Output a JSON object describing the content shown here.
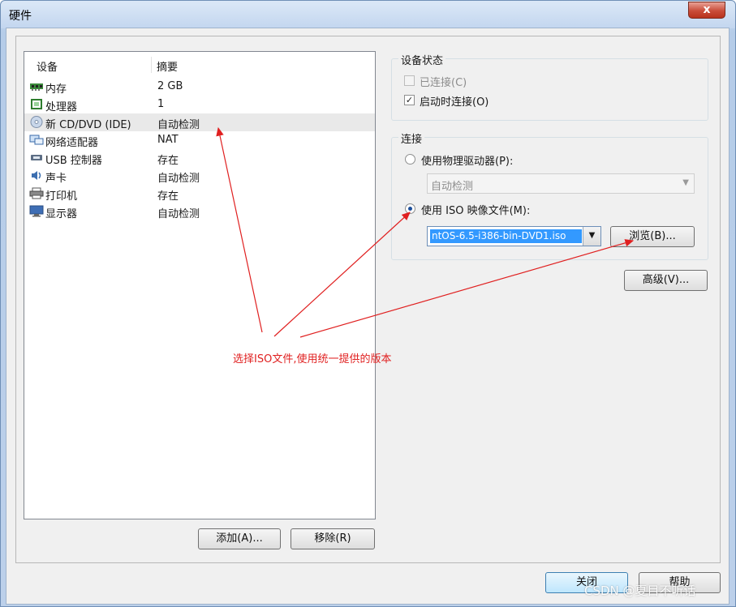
{
  "window": {
    "title": "硬件",
    "close_glyph": "x"
  },
  "device_list": {
    "header_device": "设备",
    "header_summary": "摘要",
    "rows": [
      {
        "name": "内存",
        "summary": "2 GB",
        "icon": "memory-icon"
      },
      {
        "name": "处理器",
        "summary": "1",
        "icon": "processor-icon"
      },
      {
        "name": "新 CD/DVD (IDE)",
        "summary": "自动检测",
        "icon": "cd-dvd-icon"
      },
      {
        "name": "网络适配器",
        "summary": "NAT",
        "icon": "network-adapter-icon"
      },
      {
        "name": "USB 控制器",
        "summary": "存在",
        "icon": "usb-icon"
      },
      {
        "name": "声卡",
        "summary": "自动检测",
        "icon": "sound-card-icon"
      },
      {
        "name": "打印机",
        "summary": "存在",
        "icon": "printer-icon"
      },
      {
        "name": "显示器",
        "summary": "自动检测",
        "icon": "display-icon"
      }
    ],
    "selected_index": 2
  },
  "buttons": {
    "add": "添加(A)...",
    "remove": "移除(R)",
    "browse": "浏览(B)...",
    "advanced": "高级(V)...",
    "close": "关闭",
    "help": "帮助"
  },
  "device_status": {
    "label": "设备状态",
    "connected": {
      "label": "已连接(C)",
      "checked": false,
      "enabled": false
    },
    "connect_at_power_on": {
      "label": "启动时连接(O)",
      "checked": true
    }
  },
  "connection": {
    "label": "连接",
    "physical_drive": {
      "label": "使用物理驱动器(P):",
      "selected": false,
      "value": "自动检测"
    },
    "iso_image": {
      "label": "使用 ISO 映像文件(M):",
      "selected": true,
      "value": "ntOS-6.5-i386-bin-DVD1.iso"
    }
  },
  "annotation": "选择ISO文件,使用统一提供的版本",
  "watermark": "CSDN @夏目不听话",
  "colors": {
    "annotation": "#e02020",
    "selection": "#3399ff"
  }
}
